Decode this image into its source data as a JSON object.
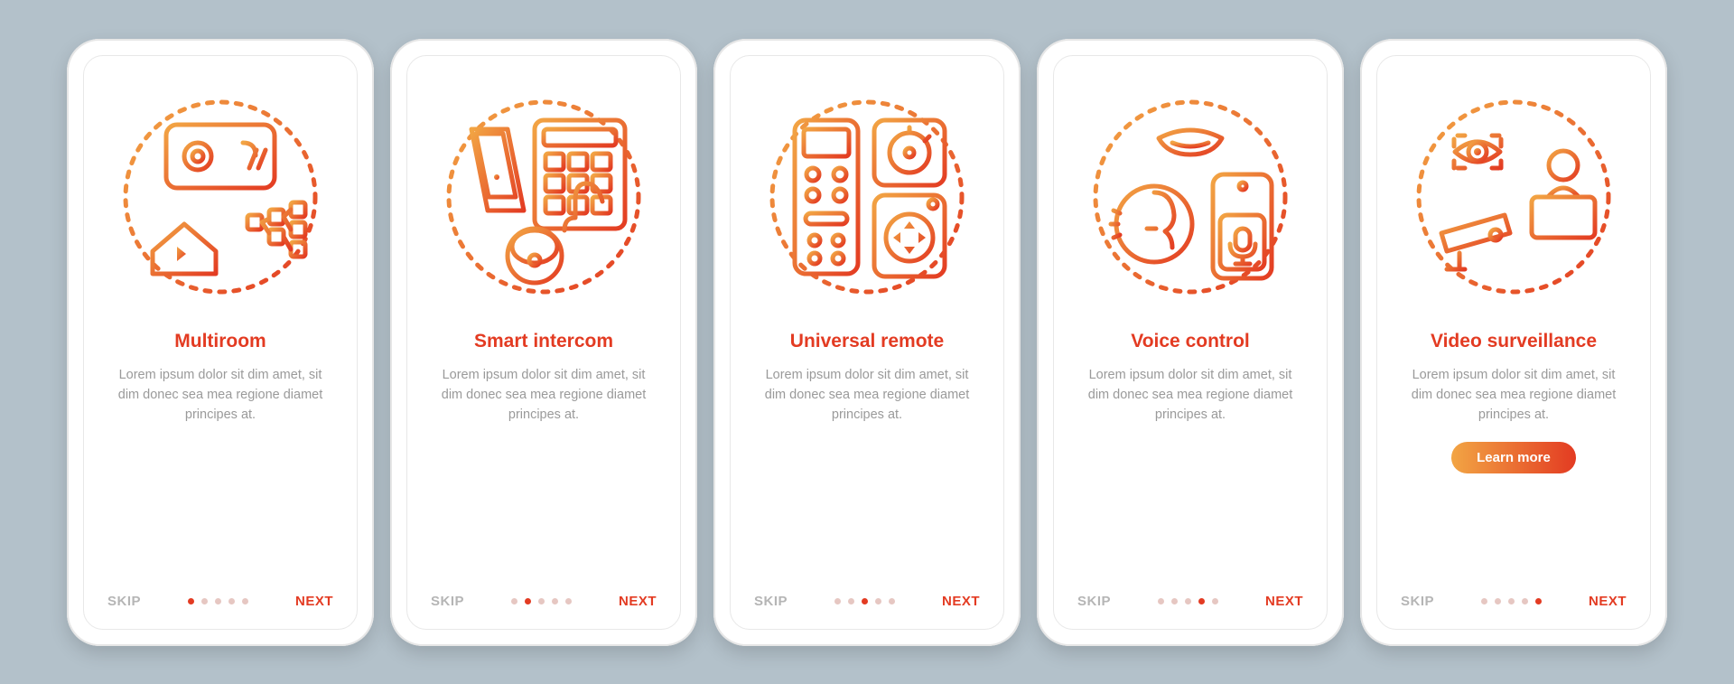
{
  "common": {
    "skip": "SKIP",
    "next": "NEXT",
    "learn_more": "Learn more",
    "lorem": "Lorem ipsum dolor sit dim amet, sit dim donec sea mea regione diamet principes at."
  },
  "screens": [
    {
      "title": "Multiroom",
      "icon": "multiroom-icon",
      "active": 0,
      "learn_more": false
    },
    {
      "title": "Smart intercom",
      "icon": "smart-intercom-icon",
      "active": 1,
      "learn_more": false
    },
    {
      "title": "Universal remote",
      "icon": "universal-remote-icon",
      "active": 2,
      "learn_more": false
    },
    {
      "title": "Voice control",
      "icon": "voice-control-icon",
      "active": 3,
      "learn_more": false
    },
    {
      "title": "Video surveillance",
      "icon": "video-surveillance-icon",
      "active": 4,
      "learn_more": true
    }
  ],
  "colors": {
    "accent": "#e33b22",
    "accent_light": "#f2a544",
    "muted": "#9a9a9a"
  }
}
